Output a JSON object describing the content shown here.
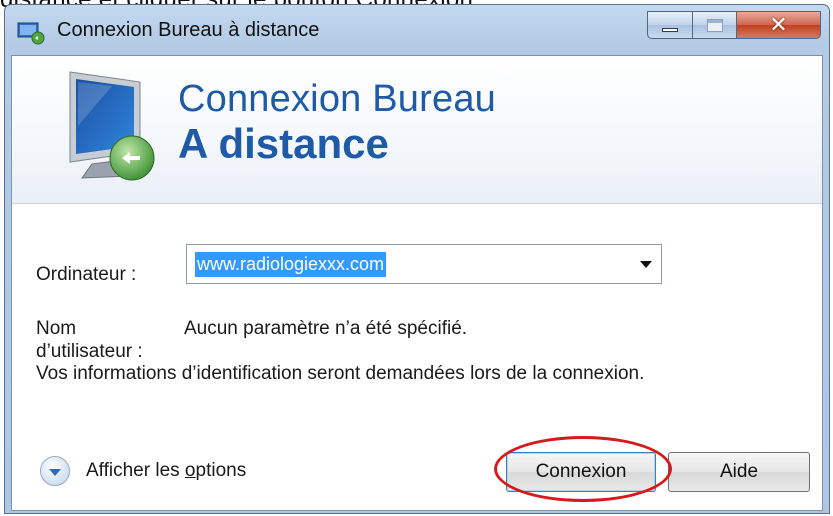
{
  "caption_fragment": "distance et cliquer sur le bouton Connexion",
  "window": {
    "title": "Connexion Bureau à distance",
    "controls": {
      "minimize_icon": "minimize-icon",
      "maximize_icon": "maximize-icon",
      "close_icon": "close-icon"
    }
  },
  "banner": {
    "line1": "Connexion Bureau",
    "line2": "A distance"
  },
  "form": {
    "computer_label": "Ordinateur :",
    "computer_value": "www.radiologiexxx.com",
    "user_label_line1": "Nom",
    "user_label_line2": "d’utilisateur :",
    "user_value": "Aucun paramètre n’a été spécifié.",
    "info_text": "Vos informations d’identification seront demandées lors de la connexion."
  },
  "footer": {
    "options_prefix": "Afficher les ",
    "options_underlined": "o",
    "options_suffix": "ptions",
    "connect_label": "Connexion",
    "help_label": "Aide"
  },
  "colors": {
    "accent_blue": "#1e5aa8",
    "selection": "#3399ff",
    "annotation_red": "#d7191c"
  }
}
